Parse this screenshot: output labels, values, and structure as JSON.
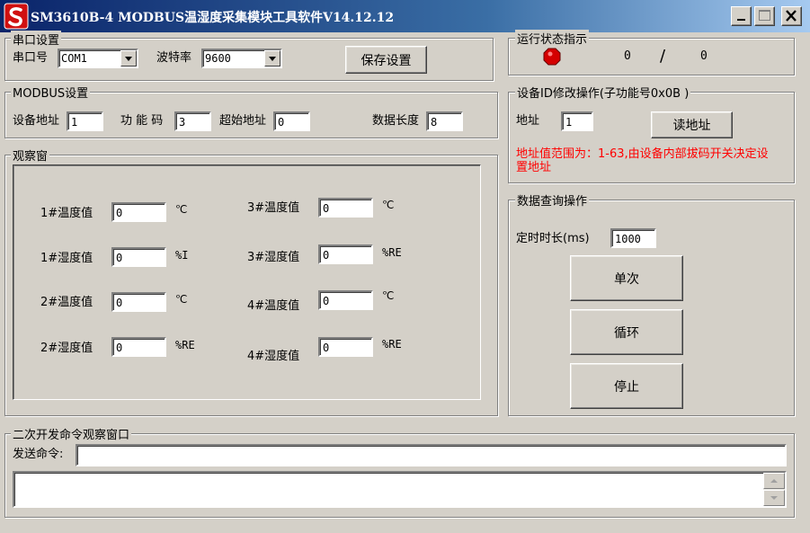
{
  "window": {
    "title": "SM3610B-4 MODBUS温湿度采集模块工具软件V14.12.12",
    "min_label": "_",
    "close_label": "✕"
  },
  "serial": {
    "group_title": "串口设置",
    "port_label": "串口号",
    "port_value": "COM1",
    "baud_label": "波特率",
    "baud_value": "9600",
    "save_button": "保存设置"
  },
  "status": {
    "group_title": "运行状态指示",
    "count_a": "0",
    "separator": "/",
    "count_b": "0",
    "led_color": "#e00000"
  },
  "modbus": {
    "group_title": "MODBUS设置",
    "dev_addr_label": "设备地址",
    "dev_addr_value": "1",
    "func_label": "功 能 码",
    "func_value": "3",
    "start_addr_label": "超始地址",
    "start_addr_value": "0",
    "data_len_label": "数据长度",
    "data_len_value": "8"
  },
  "device_id": {
    "group_title": "设备ID修改操作(子功能号0x0B )",
    "addr_label": "地址",
    "addr_value": "1",
    "read_button": "读地址",
    "note": "地址值范围为：1-63,由设备内部拔码开关决定设置地址"
  },
  "observe": {
    "group_title": "观察窗",
    "rows": [
      {
        "label": "1#温度值",
        "value": "0",
        "unit": "℃"
      },
      {
        "label": "1#湿度值",
        "value": "0",
        "unit": "%I"
      },
      {
        "label": "2#温度值",
        "value": "0",
        "unit": "℃"
      },
      {
        "label": "2#湿度值",
        "value": "0",
        "unit": "%RE"
      },
      {
        "label": "3#温度值",
        "value": "0",
        "unit": "℃"
      },
      {
        "label": "3#湿度值",
        "value": "0",
        "unit": "%RE"
      },
      {
        "label": "4#温度值",
        "value": "0",
        "unit": "℃"
      },
      {
        "label": "4#湿度值",
        "value": "0",
        "unit": "%RE"
      }
    ]
  },
  "query": {
    "group_title": "数据查询操作",
    "timer_label": "定时时长(ms)",
    "timer_value": "1000",
    "single_button": "单次",
    "loop_button": "循环",
    "stop_button": "停止"
  },
  "console": {
    "group_title": "二次开发命令观察窗口",
    "send_label": "发送命令:",
    "send_value": "",
    "output_value": ""
  }
}
